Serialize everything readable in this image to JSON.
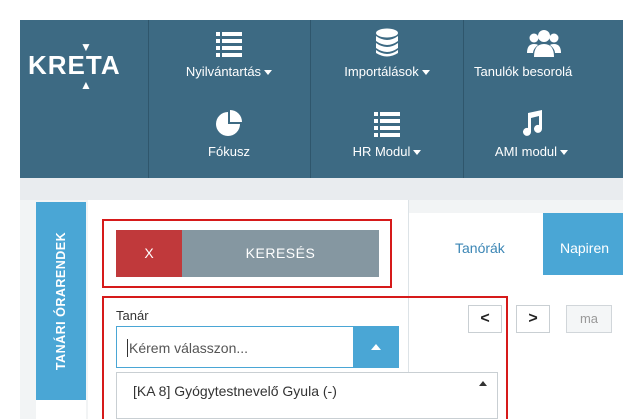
{
  "app": {
    "logo": "KRETA",
    "brand_color": "#3d6a83",
    "accent_color": "#4aa6d5",
    "danger_color": "#c0393b"
  },
  "navbar": {
    "row1": [
      {
        "label": "Nyilvántartás",
        "icon": "list-icon",
        "has_caret": true
      },
      {
        "label": "Importálások",
        "icon": "database-icon",
        "has_caret": true
      },
      {
        "label": "Tanulók besorolá",
        "icon": "users-icon",
        "has_caret": false
      }
    ],
    "row2": [
      {
        "label": "Fókusz",
        "icon": "pie-chart-icon",
        "has_caret": false
      },
      {
        "label": "HR Modul",
        "icon": "list-icon",
        "has_caret": true
      },
      {
        "label": "AMI modul",
        "icon": "music-icon",
        "has_caret": true
      }
    ]
  },
  "sidebar": {
    "vertical_tab_label": "TANÁRI ÓRARENDEK"
  },
  "search_panel": {
    "clear_label": "X",
    "search_label": "KERESÉS",
    "teacher_field_label": "Tanár",
    "teacher_placeholder": "Kérem válasszon...",
    "dropdown_items": [
      "[KA 8] Gyógytestnevelő Gyula (-)"
    ]
  },
  "schedule": {
    "tabs": [
      "Tanórák",
      "Napiren"
    ],
    "active_tab_index": 1,
    "prev_label": "<",
    "next_label": ">",
    "today_label": "ma"
  }
}
